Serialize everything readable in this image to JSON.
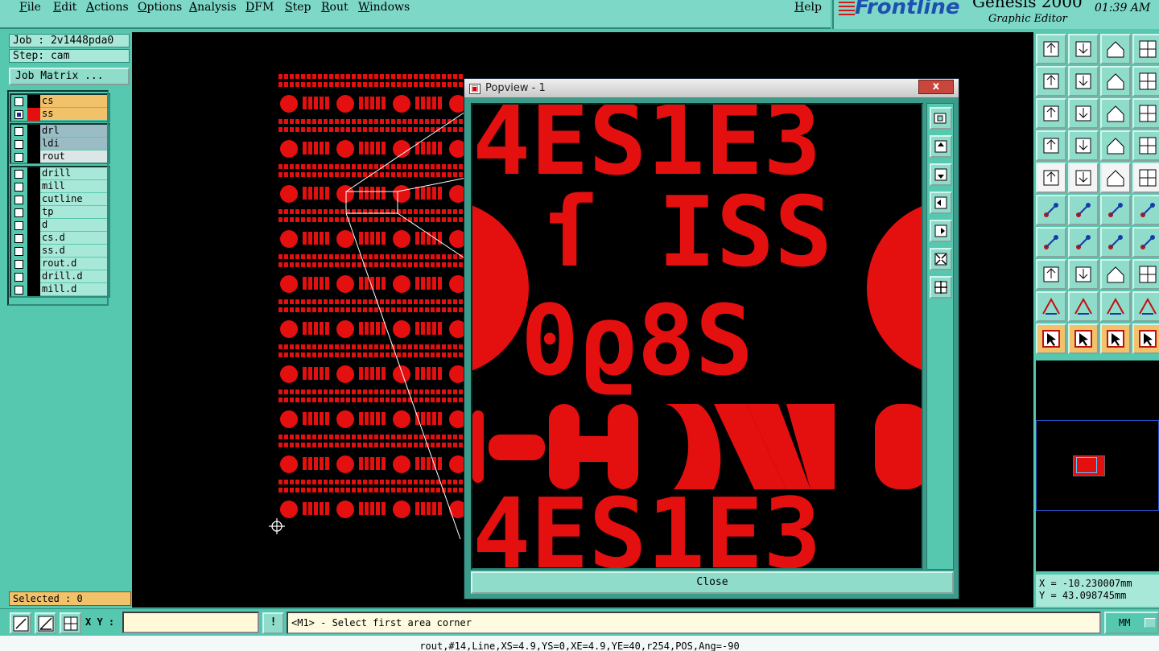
{
  "menu": [
    "File",
    "Edit",
    "Actions",
    "Options",
    "Analysis",
    "DFM",
    "Step",
    "Rout",
    "Windows"
  ],
  "help": "Help",
  "brand": {
    "logo": "Frontline",
    "app": "Genesis 2000",
    "subtitle": "Graphic Editor",
    "time": "01:39 AM"
  },
  "job": {
    "job_line": "Job : 2v1448pda0",
    "step_line": "Step: cam",
    "matrix_button": "Job Matrix ..."
  },
  "layers": {
    "group1": [
      {
        "name": "cs",
        "color": "#f2c26a",
        "swatch": "#000000",
        "checked": false
      },
      {
        "name": "ss",
        "color": "#f2c26a",
        "swatch": "#e40f0f",
        "checked": true
      }
    ],
    "group2": [
      {
        "name": "drl",
        "color": "#9bbcc4"
      },
      {
        "name": "ldi",
        "color": "#9bbcc4"
      },
      {
        "name": "rout",
        "color": "#dde6e6"
      }
    ],
    "group3": [
      {
        "name": "drill"
      },
      {
        "name": "mill"
      },
      {
        "name": "cutline"
      },
      {
        "name": "tp"
      },
      {
        "name": "d"
      },
      {
        "name": "cs.d"
      },
      {
        "name": "ss.d"
      },
      {
        "name": "rout.d"
      },
      {
        "name": "drill.d"
      },
      {
        "name": "mill.d"
      }
    ]
  },
  "selected": "Selected : 0",
  "popview": {
    "title": "Popview - 1",
    "close_button": "Close",
    "close_x": "x"
  },
  "coords": {
    "x": "X = -10.230007mm",
    "y": "Y = 43.098745mm"
  },
  "bottom": {
    "xy_label": "X Y :",
    "xy_value": "",
    "exclaim": "!",
    "prompt": "<M1> - Select first area corner",
    "units": "MM"
  },
  "status_line": "rout,#14,Line,XS=4.9,YS=0,XE=4.9,YE=40,r254,POS,Ang=-90",
  "colors": {
    "panel": "#56c8b0",
    "field": "#a8e8d8",
    "highlight": "#f2c26a",
    "feature": "#e40f0f",
    "canvas": "#000000"
  }
}
